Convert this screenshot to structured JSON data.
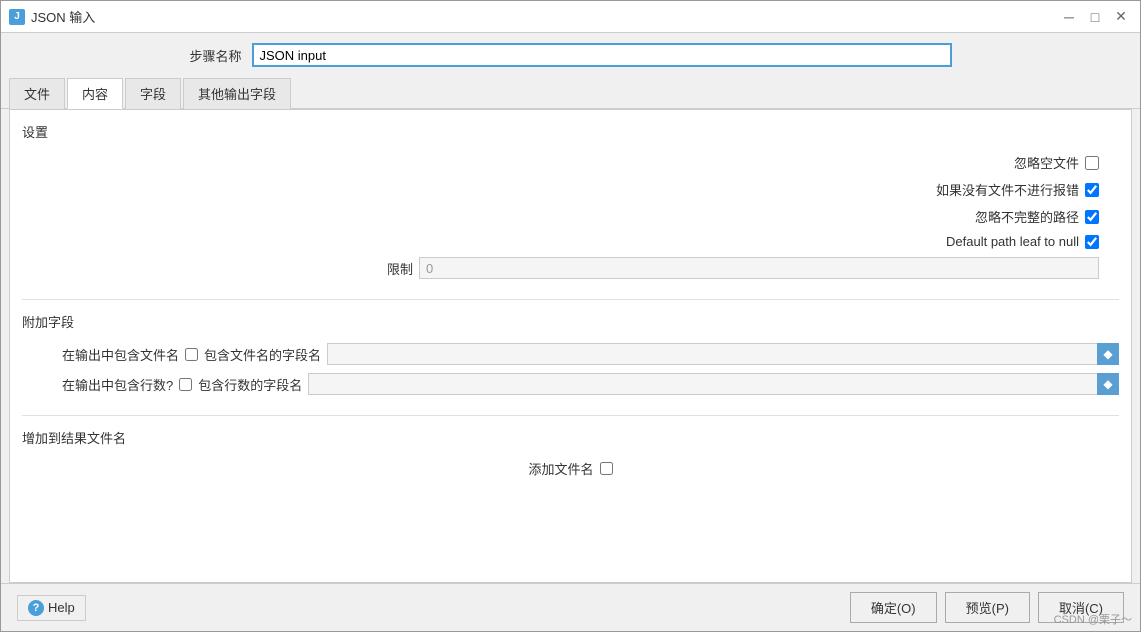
{
  "window": {
    "title": "JSON 输入",
    "icon_label": "J"
  },
  "title_controls": {
    "minimize": "─",
    "maximize": "□",
    "close": "✕"
  },
  "step_name": {
    "label": "步骤名称",
    "value": "JSON input"
  },
  "tabs": [
    {
      "id": "file",
      "label": "文件",
      "active": false
    },
    {
      "id": "content",
      "label": "内容",
      "active": true
    },
    {
      "id": "fields",
      "label": "字段",
      "active": false
    },
    {
      "id": "other_output",
      "label": "其他输出字段",
      "active": false
    }
  ],
  "settings_section": {
    "title": "设置",
    "ignore_empty_files": {
      "label": "忽略空文件",
      "checked": false
    },
    "error_if_no_files": {
      "label": "如果没有文件不进行报错",
      "checked": true
    },
    "ignore_incomplete_path": {
      "label": "忽略不完整的路径",
      "checked": true
    },
    "default_path_leaf_to_null": {
      "label": "Default path leaf to null",
      "checked": true
    },
    "limit": {
      "label": "限制",
      "value": "0",
      "placeholder": "0"
    }
  },
  "additional_fields_section": {
    "title": "附加字段",
    "include_filename": {
      "label": "在输出中包含文件名",
      "checked": false,
      "field_label": "包含文件名的字段名",
      "value": ""
    },
    "include_row_count": {
      "label": "在输出中包含行数?",
      "checked": false,
      "field_label": "包含行数的字段名",
      "value": ""
    }
  },
  "add_to_result_section": {
    "title": "增加到结果文件名",
    "add_filename": {
      "label": "添加文件名",
      "checked": false
    }
  },
  "bottom": {
    "help_label": "Help",
    "confirm_label": "确定(O)",
    "preview_label": "预览(P)",
    "cancel_label": "取消(C)"
  },
  "watermark": "CSDN @栗子～"
}
